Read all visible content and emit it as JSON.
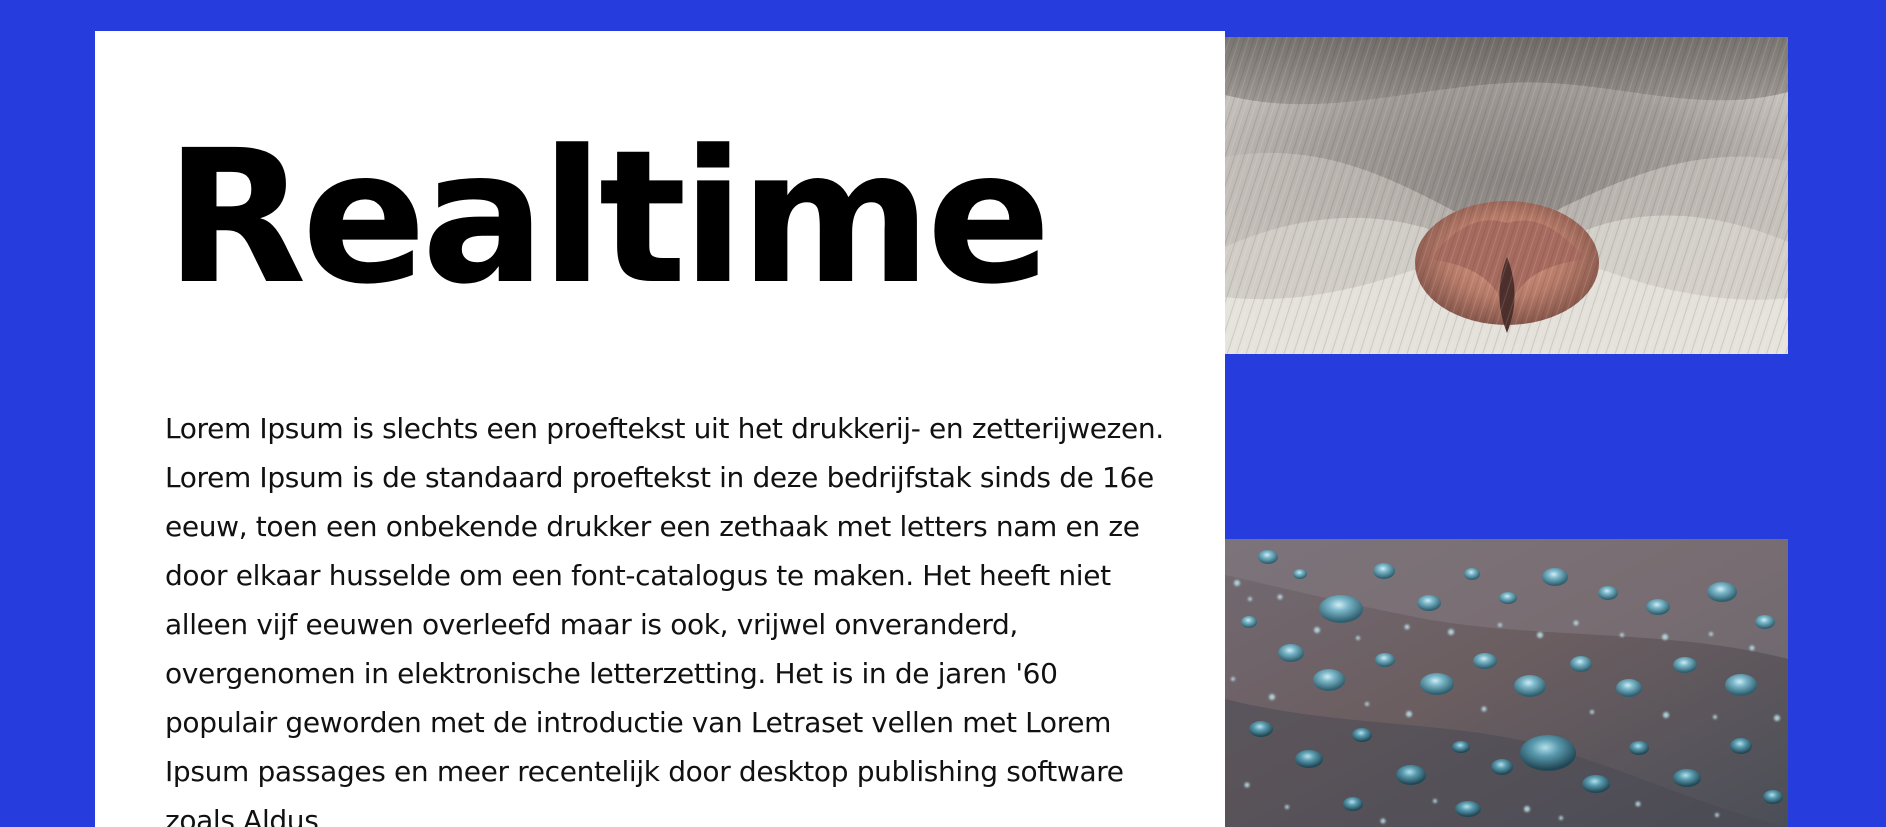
{
  "article": {
    "title": "Realtime",
    "body": "Lorem Ipsum is slechts een proeftekst uit het drukkerij- en zetterijwezen. Lorem Ipsum is de standaard proeftekst in deze bedrijfstak sinds de 16e eeuw, toen een onbekende drukker een zethaak met letters nam en ze door elkaar husselde om een font-catalogus te maken. Het heeft niet alleen vijf eeuwen overleefd maar is ook, vrijwel onveranderd, overgenomen in elektronische letterzetting. Het is in de jaren '60 populair geworden met de introductie van Letraset vellen met Lorem Ipsum passages en meer recentelijk door desktop publishing software zoals Aldus"
  },
  "colors": {
    "background": "#263cdc",
    "card": "#ffffff",
    "title": "#000000",
    "text": "#111111"
  },
  "images": {
    "top": "cat-nose-photo",
    "bottom": "water-droplets-photo"
  }
}
